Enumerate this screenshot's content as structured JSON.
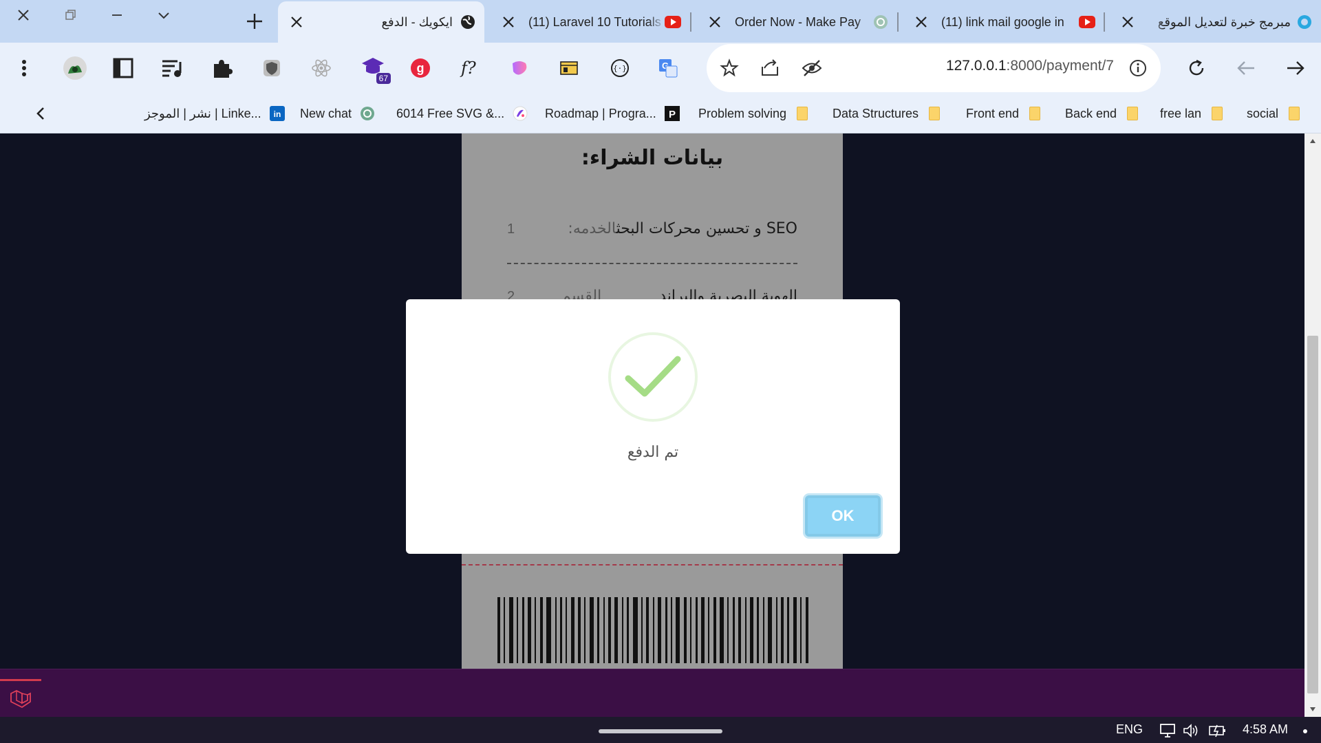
{
  "browser": {
    "tabs": [
      {
        "title": "ايكويك - الدفع",
        "icon": "globe-icon",
        "active": true
      },
      {
        "title": "(11) Laravel 10 Tutorials",
        "icon": "youtube-icon",
        "active": false
      },
      {
        "title": "Order Now - Make Pay",
        "icon": "chatgpt-icon",
        "active": false
      },
      {
        "title": "(11) link mail google in",
        "icon": "youtube-icon",
        "active": false
      },
      {
        "title": "مبرمج خبرة لتعديل الموقع",
        "icon": "circle-icon",
        "active": false
      }
    ],
    "extension_badge": "67",
    "url_host": "127.0.0.1",
    "url_path": ":8000/payment/7",
    "bookmarks": [
      {
        "label": "نشر | الموجز | Linke...",
        "icon": "linkedin-icon"
      },
      {
        "label": "New chat",
        "icon": "chatgpt-icon"
      },
      {
        "label": "6014 Free SVG &...",
        "icon": "svg-site-icon"
      },
      {
        "label": "Roadmap | Progra...",
        "icon": "p-logo-icon"
      },
      {
        "label": "Problem solving",
        "icon": "folder-icon"
      },
      {
        "label": "Data Structures",
        "icon": "folder-icon"
      },
      {
        "label": "Front end",
        "icon": "folder-icon"
      },
      {
        "label": "Back end",
        "icon": "folder-icon"
      },
      {
        "label": "free lan",
        "icon": "folder-icon"
      },
      {
        "label": "social",
        "icon": "folder-icon"
      }
    ]
  },
  "receipt": {
    "title": ":بيانات الشراء",
    "rows": [
      {
        "num": "1",
        "key": "الخدمه:",
        "value": "SEO و تحسين محركات البحث"
      },
      {
        "num": "2",
        "key": "القسم",
        "value": "الهوية البصرية والبراند"
      }
    ]
  },
  "modal": {
    "message": "تم الدفع",
    "ok_label": "OK"
  },
  "taskbar": {
    "language": "ENG",
    "time": "4:58 AM"
  },
  "colors": {
    "tab_strip": "#c4d8f3",
    "toolbar": "#e9f0fb",
    "page_bg": "#0f1222",
    "ok_button": "#8cd4f5",
    "success_check": "#a5dc86"
  }
}
